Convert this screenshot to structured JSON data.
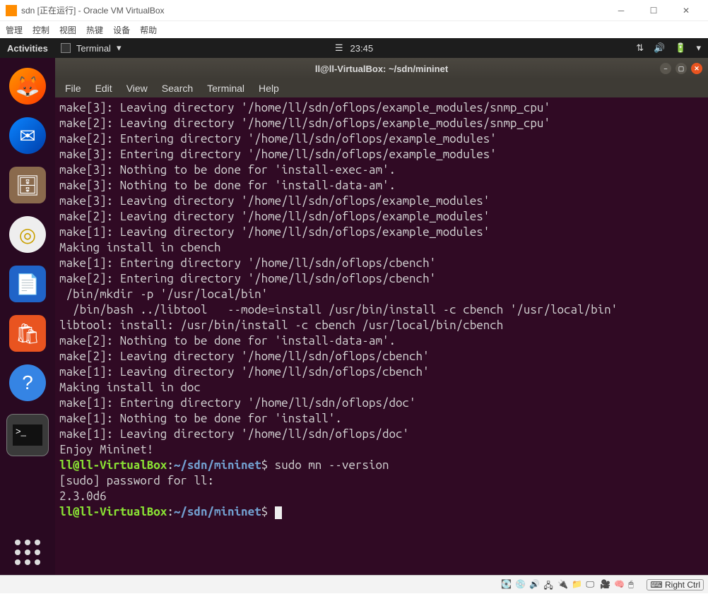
{
  "virtualbox": {
    "title": "sdn [正在运行] - Oracle VM VirtualBox",
    "menu": [
      "管理",
      "控制",
      "视图",
      "热键",
      "设备",
      "帮助"
    ],
    "status_host_key": "Right Ctrl"
  },
  "ubuntu": {
    "activities": "Activities",
    "app_indicator": "Terminal",
    "clock": "23:45",
    "dock": [
      {
        "name": "firefox",
        "glyph": "🦊"
      },
      {
        "name": "thunderbird",
        "glyph": "✉"
      },
      {
        "name": "files",
        "glyph": "🗄"
      },
      {
        "name": "rhythmbox",
        "glyph": "◎"
      },
      {
        "name": "writer",
        "glyph": "📄"
      },
      {
        "name": "software",
        "glyph": "🛍"
      },
      {
        "name": "help",
        "glyph": "?"
      },
      {
        "name": "terminal",
        "glyph": ">_"
      }
    ]
  },
  "terminal": {
    "title": "ll@ll-VirtualBox: ~/sdn/mininet",
    "menu": [
      "File",
      "Edit",
      "View",
      "Search",
      "Terminal",
      "Help"
    ],
    "lines": [
      "make[3]: Leaving directory '/home/ll/sdn/oflops/example_modules/snmp_cpu'",
      "make[2]: Leaving directory '/home/ll/sdn/oflops/example_modules/snmp_cpu'",
      "make[2]: Entering directory '/home/ll/sdn/oflops/example_modules'",
      "make[3]: Entering directory '/home/ll/sdn/oflops/example_modules'",
      "make[3]: Nothing to be done for 'install-exec-am'.",
      "make[3]: Nothing to be done for 'install-data-am'.",
      "make[3]: Leaving directory '/home/ll/sdn/oflops/example_modules'",
      "make[2]: Leaving directory '/home/ll/sdn/oflops/example_modules'",
      "make[1]: Leaving directory '/home/ll/sdn/oflops/example_modules'",
      "Making install in cbench",
      "make[1]: Entering directory '/home/ll/sdn/oflops/cbench'",
      "make[2]: Entering directory '/home/ll/sdn/oflops/cbench'",
      " /bin/mkdir -p '/usr/local/bin'",
      "  /bin/bash ../libtool   --mode=install /usr/bin/install -c cbench '/usr/local/bin'",
      "libtool: install: /usr/bin/install -c cbench /usr/local/bin/cbench",
      "make[2]: Nothing to be done for 'install-data-am'.",
      "make[2]: Leaving directory '/home/ll/sdn/oflops/cbench'",
      "make[1]: Leaving directory '/home/ll/sdn/oflops/cbench'",
      "Making install in doc",
      "make[1]: Entering directory '/home/ll/sdn/oflops/doc'",
      "make[1]: Nothing to be done for 'install'.",
      "make[1]: Leaving directory '/home/ll/sdn/oflops/doc'",
      "Enjoy Mininet!"
    ],
    "prompt": {
      "user": "ll@ll-VirtualBox",
      "sep1": ":",
      "path": "~/sdn/mininet",
      "sigil": "$"
    },
    "command1": "sudo mn --version",
    "sudo_prompt": "[sudo] password for ll: ",
    "version_output": "2.3.0d6"
  }
}
